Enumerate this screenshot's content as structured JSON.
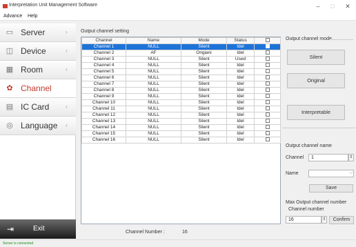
{
  "window": {
    "title": "Interpretation Unit Management Software",
    "minimize": "–",
    "maximize": "□",
    "close": "✕"
  },
  "menu": [
    "Advance",
    "Help"
  ],
  "sidebar": {
    "items": [
      {
        "label": "Server",
        "icon": "monitor-icon"
      },
      {
        "label": "Device",
        "icon": "device-icon"
      },
      {
        "label": "Room",
        "icon": "grid-icon"
      },
      {
        "label": "Channel",
        "icon": "channel-icon"
      },
      {
        "label": "IC Card",
        "icon": "card-icon"
      },
      {
        "label": "Language",
        "icon": "globe-icon"
      }
    ],
    "active": "Channel",
    "exit_label": "Exit"
  },
  "channel_table": {
    "group_title": "Output channel setting",
    "headers": [
      "Channel",
      "Name",
      "Mode",
      "Status",
      ""
    ],
    "rows": [
      [
        "Channel 1",
        "NULL",
        "Silent",
        "Idel"
      ],
      [
        "Channel 2",
        "AF",
        "Origiani",
        "Idel"
      ],
      [
        "Channel 3",
        "NULL",
        "Silent",
        "Used"
      ],
      [
        "Channel 4",
        "NULL",
        "Silent",
        "Idel"
      ],
      [
        "Channel 5",
        "NULL",
        "Silent",
        "Idel"
      ],
      [
        "Channel 6",
        "NULL",
        "Silent",
        "Idel"
      ],
      [
        "Channel 7",
        "NULL",
        "Silent",
        "Idel"
      ],
      [
        "Channel 8",
        "NULL",
        "Silent",
        "Idel"
      ],
      [
        "Channel 9",
        "NULL",
        "Silent",
        "Idel"
      ],
      [
        "Channel 10",
        "NULL",
        "Silent",
        "Idel"
      ],
      [
        "Channel 11",
        "NULL",
        "Silent",
        "Idel"
      ],
      [
        "Channel 12",
        "NULL",
        "Silent",
        "Idel"
      ],
      [
        "Channel 13",
        "NULL",
        "Silent",
        "Idel"
      ],
      [
        "Channel 14",
        "NULL",
        "Silent",
        "Idel"
      ],
      [
        "Channel 15",
        "NULL",
        "Silent",
        "Idel"
      ],
      [
        "Channel 16",
        "NULL",
        "Silent",
        "Idel"
      ]
    ],
    "selected_row": 0,
    "channel_number_label": "Channel Number :",
    "channel_number_value": "16"
  },
  "right_panel": {
    "mode_title": "Output channel mode",
    "mode_buttons": [
      "Silent",
      "Original",
      "Interpretable"
    ],
    "name_title": "Output channel name",
    "channel_label": "Channel",
    "channel_value": "1",
    "name_label": "Name",
    "name_value": "",
    "save_label": "Save",
    "max_title": "Max Output channel number",
    "channel_number_label": "Channel number",
    "max_value": "16",
    "confirm_label": "Confirm"
  },
  "status": {
    "text": "Server is connected"
  },
  "colors": {
    "selection": "#1e73d8",
    "active_nav": "#c0392b",
    "status_ok": "#1a8a1a"
  }
}
